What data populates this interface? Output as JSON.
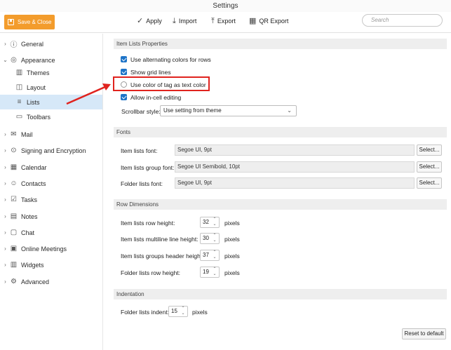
{
  "window": {
    "title": "Settings"
  },
  "toolbar": {
    "save_close_label": "Save & Close",
    "apply_label": "Apply",
    "import_label": "Import",
    "export_label": "Export",
    "qr_export_label": "QR Export",
    "search_placeholder": "Search"
  },
  "sidebar": {
    "items": [
      {
        "label": "General",
        "icon": "info-icon",
        "chevron": "›"
      },
      {
        "label": "Appearance",
        "icon": "palette-icon",
        "chevron": "⌄"
      },
      {
        "label": "Themes",
        "icon": "paint-roller-icon"
      },
      {
        "label": "Layout",
        "icon": "layout-icon"
      },
      {
        "label": "Lists",
        "icon": "list-icon"
      },
      {
        "label": "Toolbars",
        "icon": "toolbar-icon"
      },
      {
        "label": "Mail",
        "icon": "mail-icon",
        "chevron": "›"
      },
      {
        "label": "Signing and Encryption",
        "icon": "lock-icon",
        "chevron": "›"
      },
      {
        "label": "Calendar",
        "icon": "calendar-icon",
        "chevron": "›"
      },
      {
        "label": "Contacts",
        "icon": "contacts-icon",
        "chevron": "›"
      },
      {
        "label": "Tasks",
        "icon": "tasks-icon",
        "chevron": "›"
      },
      {
        "label": "Notes",
        "icon": "notes-icon",
        "chevron": "›"
      },
      {
        "label": "Chat",
        "icon": "chat-icon",
        "chevron": "›"
      },
      {
        "label": "Online Meetings",
        "icon": "meetings-icon",
        "chevron": "›"
      },
      {
        "label": "Widgets",
        "icon": "widgets-icon",
        "chevron": "›"
      },
      {
        "label": "Advanced",
        "icon": "gear-icon",
        "chevron": "›"
      }
    ],
    "active": "Lists"
  },
  "item_lists_properties": {
    "heading": "Item Lists Properties",
    "alternating_colors": {
      "label": "Use alternating colors for rows",
      "checked": true
    },
    "grid_lines": {
      "label": "Show grid lines",
      "checked": true
    },
    "tag_color": {
      "label": "Use color of tag as text color",
      "checked": false
    },
    "in_cell_editing": {
      "label": "Allow in-cell editing",
      "checked": true
    },
    "scrollbar_style_label": "Scrollbar style:",
    "scrollbar_style_value": "Use setting from theme"
  },
  "fonts": {
    "heading": "Fonts",
    "select_label": "Select...",
    "rows": [
      {
        "label": "Item lists font:",
        "value": "Segoe UI, 9pt"
      },
      {
        "label": "Item lists group font:",
        "value": "Segoe UI Semibold, 10pt"
      },
      {
        "label": "Folder lists font:",
        "value": "Segoe UI, 9pt"
      }
    ]
  },
  "row_dimensions": {
    "heading": "Row Dimensions",
    "unit": "pixels",
    "rows": [
      {
        "label": "Item lists row height:",
        "value": "32"
      },
      {
        "label": "Item lists multiline line height:",
        "value": "30"
      },
      {
        "label": "Item lists groups header height:",
        "value": "37"
      },
      {
        "label": "Folder lists row height:",
        "value": "19"
      }
    ]
  },
  "indentation": {
    "heading": "Indentation",
    "label": "Folder lists indent:",
    "value": "15",
    "unit": "pixels"
  },
  "reset_label": "Reset to default",
  "colors": {
    "accent": "#f39c2c",
    "selection": "#d6e8f8",
    "checkbox": "#1e74c8",
    "annotation": "#e0231e"
  }
}
